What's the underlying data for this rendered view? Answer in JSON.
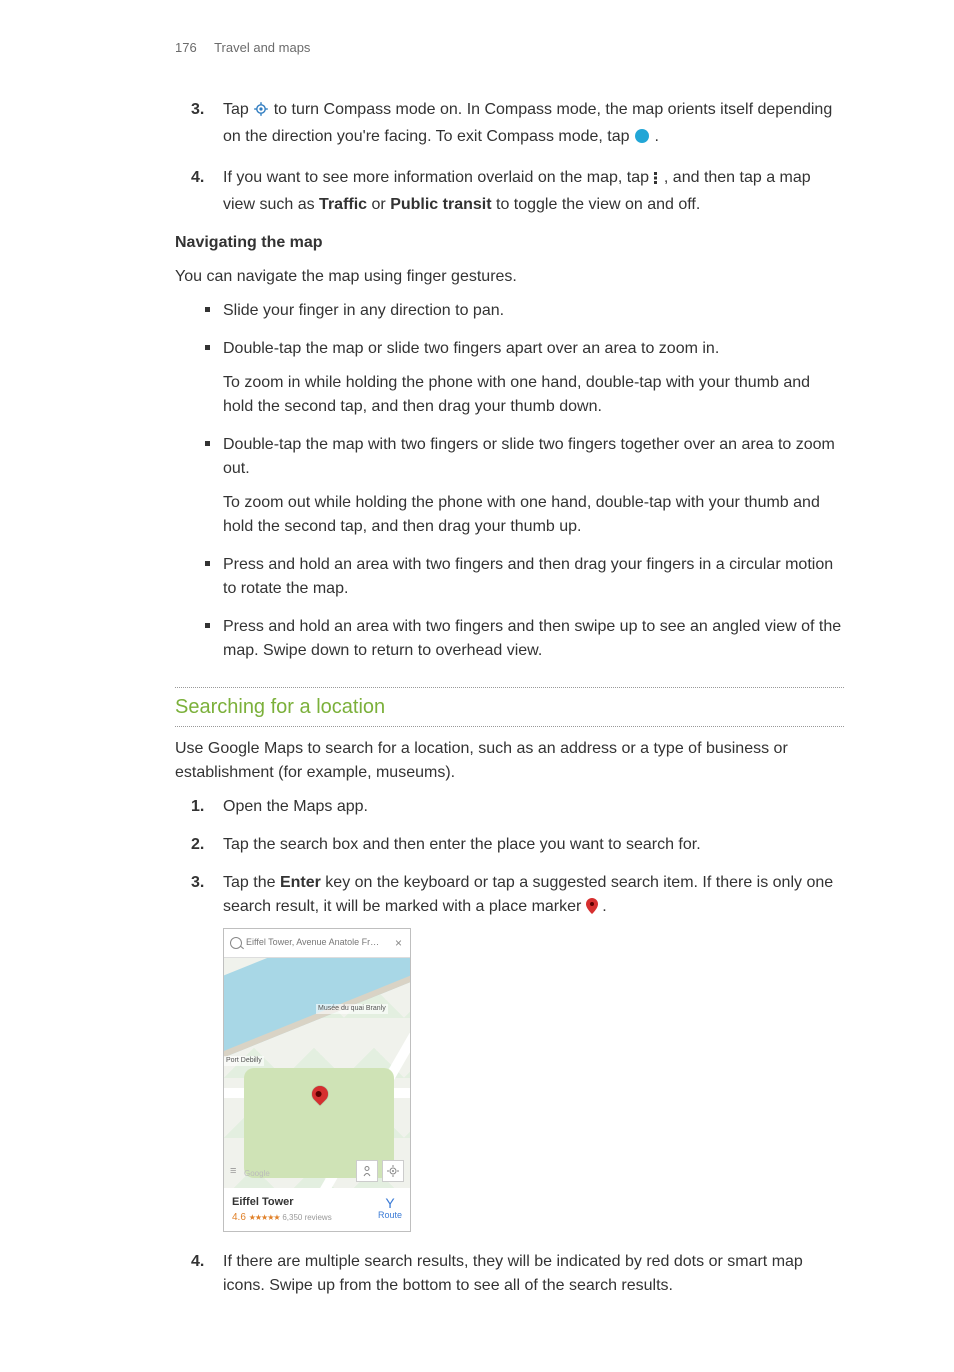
{
  "page_header": {
    "number": "176",
    "section": "Travel and maps"
  },
  "steps_a": {
    "s3_a": "Tap ",
    "s3_b": " to turn Compass mode on. In Compass mode, the map orients itself depending on the direction you're facing. To exit Compass mode, tap ",
    "s3_c": ".",
    "s4_a": "If you want to see more information overlaid on the map, tap ",
    "s4_b": ", and then tap a map view such as ",
    "s4_traffic": "Traffic",
    "s4_or": " or ",
    "s4_transit": "Public transit",
    "s4_c": " to toggle the view on and off."
  },
  "nav_head": "Navigating the map",
  "nav_intro": "You can navigate the map using finger gestures.",
  "bullets": {
    "b1": "Slide your finger in any direction to pan.",
    "b2": "Double-tap the map or slide two fingers apart over an area to zoom in.",
    "b2p": "To zoom in while holding the phone with one hand, double-tap with your thumb and hold the second tap, and then drag your thumb down.",
    "b3": "Double-tap the map with two fingers or slide two fingers together over an area to zoom out.",
    "b3p": "To zoom out while holding the phone with one hand, double-tap with your thumb and hold the second tap, and then drag your thumb up.",
    "b4": "Press and hold an area with two fingers and then drag your fingers in a circular motion to rotate the map.",
    "b5": "Press and hold an area with two fingers and then swipe up to see an angled view of the map. Swipe down to return to overhead view."
  },
  "section_title": "Searching for a location",
  "section_intro": "Use Google Maps to search for a location, such as an address or a type of business or establishment (for example, museums).",
  "steps_b": {
    "s1": "Open the Maps app.",
    "s2": "Tap the search box and then enter the place you want to search for.",
    "s3_a": "Tap the ",
    "s3_enter": "Enter",
    "s3_b": " key on the keyboard or tap a suggested search item. If there is only one search result, it will be marked with a place marker ",
    "s3_c": ".",
    "s4": "If there are multiple search results, they will be indicated by red dots or smart map icons. Swipe up from the bottom to see all of the search results."
  },
  "shot": {
    "search_text": "Eiffel Tower, Avenue Anatole Fr…",
    "label1": "Musée du quai Branly",
    "label2": "Port Debilly",
    "google": "Google",
    "panel_title": "Eiffel Tower",
    "rating": "4.6",
    "reviews": "6,350 reviews",
    "route": "Route"
  }
}
